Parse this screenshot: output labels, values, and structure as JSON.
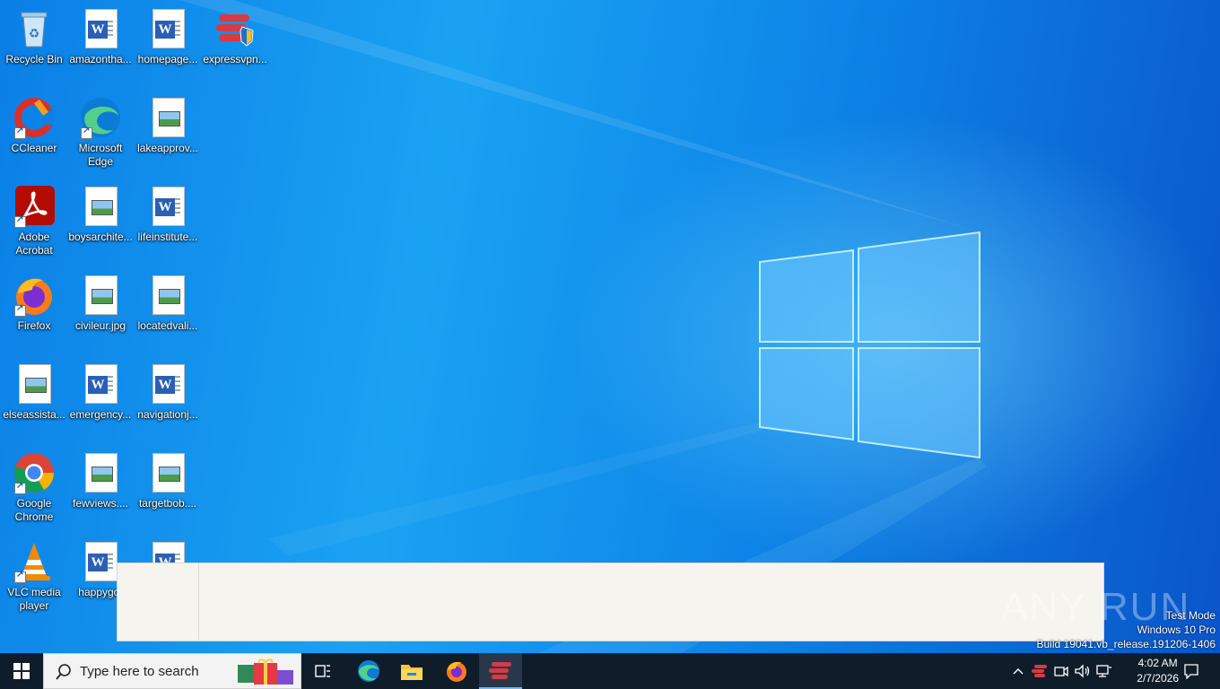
{
  "desktop": {
    "icons": [
      {
        "label": "Recycle Bin"
      },
      {
        "label": "amazontha..."
      },
      {
        "label": "homepage..."
      },
      {
        "label": "expressvpn..."
      },
      {
        "label": "CCleaner"
      },
      {
        "label": "Microsoft Edge"
      },
      {
        "label": "lakeapprov..."
      },
      {
        "label": "Adobe Acrobat"
      },
      {
        "label": "boysarchite..."
      },
      {
        "label": "lifeinstitute..."
      },
      {
        "label": "Firefox"
      },
      {
        "label": "civileur.jpg"
      },
      {
        "label": "locatedvali..."
      },
      {
        "label": "elseassista..."
      },
      {
        "label": "emergency..."
      },
      {
        "label": "navigationj..."
      },
      {
        "label": "Google Chrome"
      },
      {
        "label": "fewviews...."
      },
      {
        "label": "targetbob...."
      },
      {
        "label": "VLC media player"
      },
      {
        "label": "happygot"
      }
    ]
  },
  "watermark": {
    "brand": "ANY RUN",
    "line1": "Test Mode",
    "line2": "Windows 10 Pro",
    "line3": "Build 19041.vb_release.191206-1406"
  },
  "taskbar": {
    "search_placeholder": "Type here to search",
    "time": "4:02 AM",
    "date": "2/7/2026"
  },
  "colors": {
    "taskbar": "#0f1d2b",
    "desktop_blue": "#0a7fe6",
    "panel": "#f6f4ef"
  }
}
